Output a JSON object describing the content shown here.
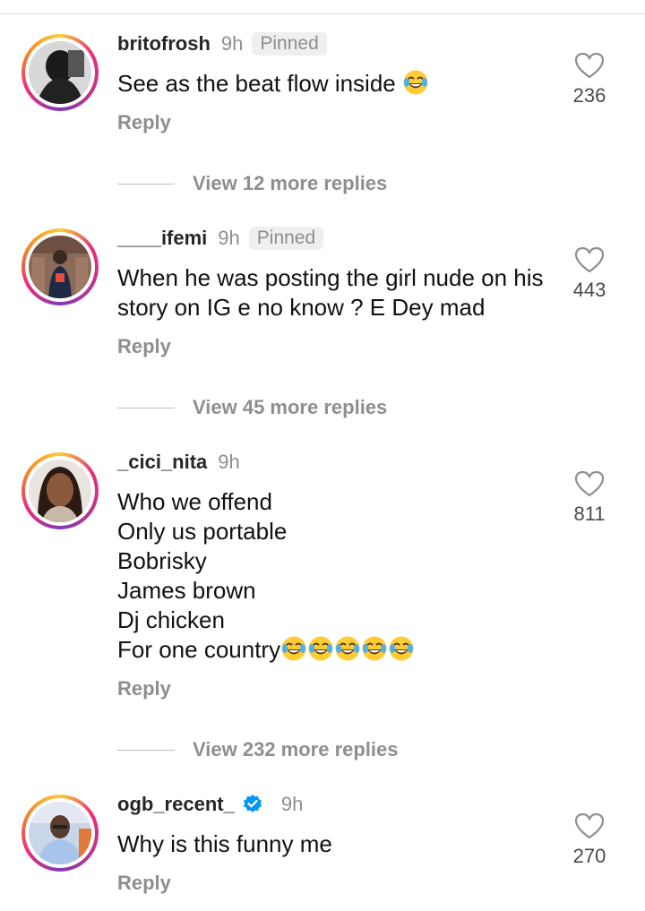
{
  "comments": [
    {
      "username": "britofrosh",
      "time": "9h",
      "pinned": "Pinned",
      "text": "See as the beat flow inside",
      "emoji": [
        "joy-emoji"
      ],
      "reply_label": "Reply",
      "likes": "236",
      "view_replies": "View 12 more replies"
    },
    {
      "username": "____ifemi",
      "time": "9h",
      "pinned": "Pinned",
      "text": "When he was posting the girl nude on his story on IG e no know ? E Dey mad",
      "reply_label": "Reply",
      "likes": "443",
      "view_replies": "View 45 more replies"
    },
    {
      "username": "_cici_nita",
      "time": "9h",
      "text": "Who we offend\nOnly us portable\nBobrisky\nJames brown\nDj chicken\nFor one country",
      "emoji": [
        "joy-emoji",
        "joy-emoji",
        "joy-emoji",
        "joy-emoji",
        "joy-emoji"
      ],
      "reply_label": "Reply",
      "likes": "811",
      "view_replies": "View 232 more replies"
    },
    {
      "username": "ogb_recent_",
      "time": "9h",
      "verified": true,
      "text": "Why is this funny me",
      "reply_label": "Reply",
      "likes": "270"
    }
  ],
  "colors": {
    "secondary_text": "#8e8e8e",
    "verified_blue": "#0095f6",
    "pinned_bg": "#efefef"
  }
}
